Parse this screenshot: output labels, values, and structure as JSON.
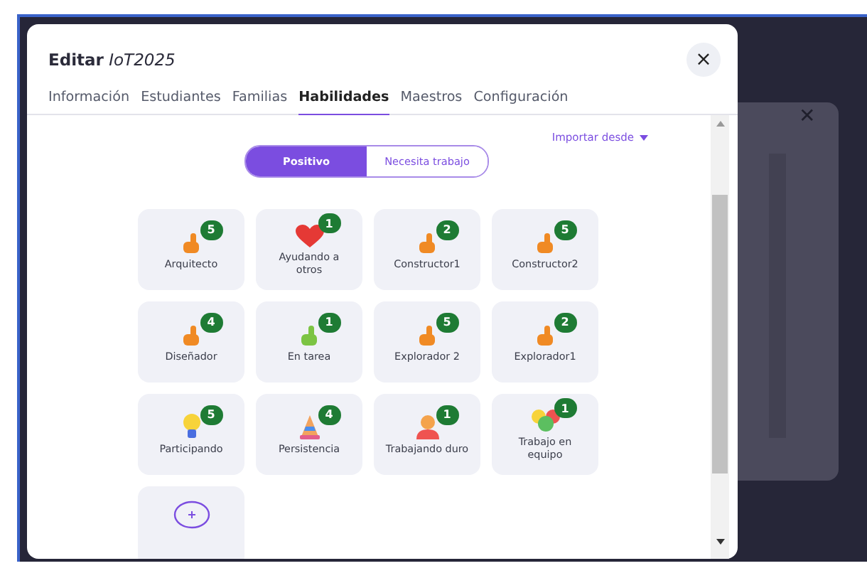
{
  "dialog": {
    "title_prefix": "Editar",
    "title_name": "IoT2025",
    "close": "×"
  },
  "tabs": [
    {
      "label": "Información",
      "selected": false
    },
    {
      "label": "Estudiantes",
      "selected": false
    },
    {
      "label": "Familias",
      "selected": false
    },
    {
      "label": "Habilidades",
      "selected": true
    },
    {
      "label": "Maestros",
      "selected": false
    },
    {
      "label": "Configuración",
      "selected": false
    }
  ],
  "import_link": "Importar desde",
  "toggle": [
    {
      "label": "Positivo",
      "selected": true
    },
    {
      "label": "Necesita trabajo",
      "selected": false
    }
  ],
  "skills": [
    {
      "kind": "thumb",
      "name": "Arquitecto",
      "count": "5"
    },
    {
      "kind": "heart",
      "name": "Ayudando a otros",
      "count": "1"
    },
    {
      "kind": "thumb",
      "name": "Constructor1",
      "count": "2"
    },
    {
      "kind": "thumb",
      "name": "Constructor2",
      "count": "5"
    },
    {
      "kind": "thumb",
      "name": "Diseñador",
      "count": "4"
    },
    {
      "kind": "greenthumb",
      "name": "En tarea",
      "count": "1"
    },
    {
      "kind": "thumb",
      "name": "Explorador 2",
      "count": "5"
    },
    {
      "kind": "thumb",
      "name": "Explorador1",
      "count": "2"
    },
    {
      "kind": "bulb",
      "name": "Participando",
      "count": "5"
    },
    {
      "kind": "cone",
      "name": "Persistencia",
      "count": "4"
    },
    {
      "kind": "worker",
      "name": "Trabajando duro",
      "count": "1"
    },
    {
      "kind": "team",
      "name": "Trabajo en equipo",
      "count": "1"
    },
    {
      "kind": "add"
    }
  ],
  "back_panel": {
    "close": "✕"
  }
}
